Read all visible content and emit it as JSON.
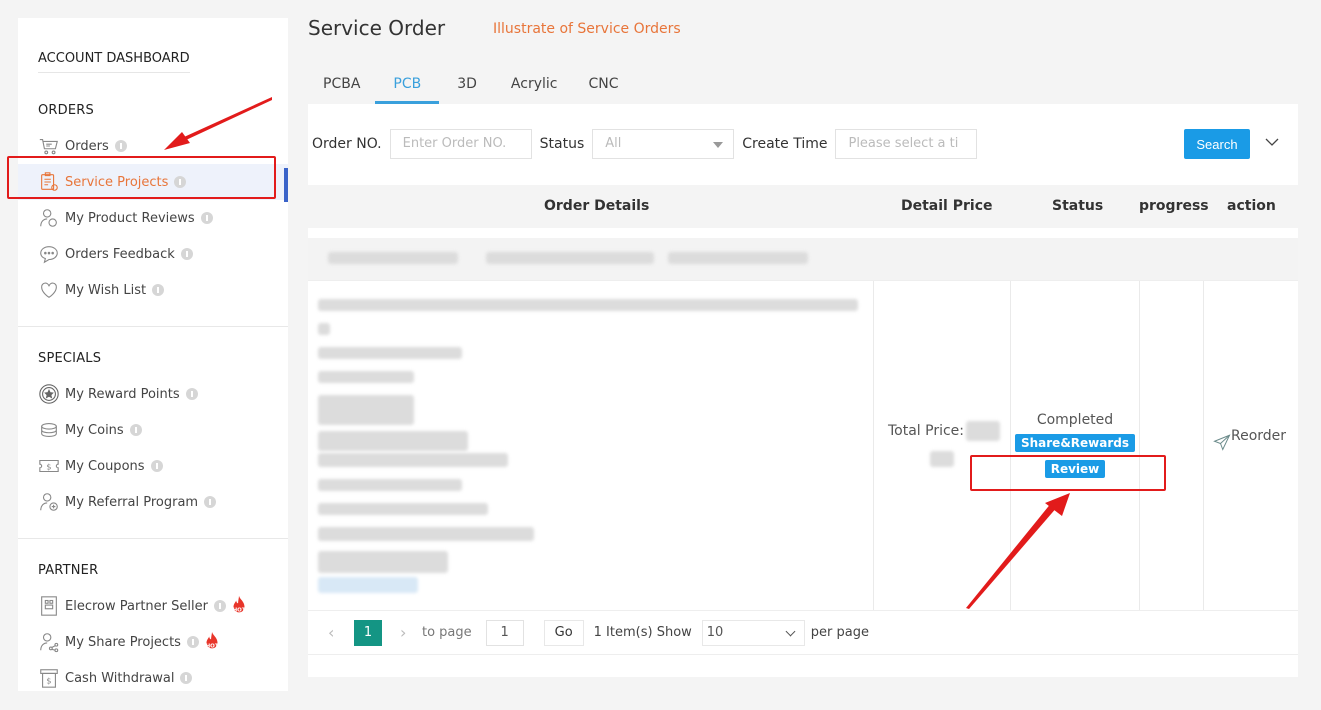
{
  "sidebar": {
    "dashboard_title": "ACCOUNT DASHBOARD",
    "sections": [
      {
        "title": "ORDERS",
        "items": [
          {
            "label": "Orders",
            "icon": "cart-icon"
          },
          {
            "label": "Service Projects",
            "icon": "clipboard-icon",
            "active": true
          },
          {
            "label": "My Product Reviews",
            "icon": "user-review-icon"
          },
          {
            "label": "Orders Feedback",
            "icon": "chat-icon"
          },
          {
            "label": "My Wish List",
            "icon": "heart-icon"
          }
        ]
      },
      {
        "title": "SPECIALS",
        "items": [
          {
            "label": "My Reward Points",
            "icon": "star-badge-icon"
          },
          {
            "label": "My Coins",
            "icon": "coins-icon"
          },
          {
            "label": "My Coupons",
            "icon": "coupon-icon"
          },
          {
            "label": "My Referral Program",
            "icon": "user-plus-icon"
          }
        ]
      },
      {
        "title": "PARTNER",
        "items": [
          {
            "label": "Elecrow Partner Seller",
            "icon": "seller-icon",
            "badge": "HOT"
          },
          {
            "label": "My Share Projects",
            "icon": "share-user-icon",
            "badge": "HOT"
          },
          {
            "label": "Cash Withdrawal",
            "icon": "cash-icon"
          }
        ]
      }
    ]
  },
  "header": {
    "title": "Service Order",
    "illustrate_link": "Illustrate of Service Orders"
  },
  "tabs": [
    {
      "label": "PCBA"
    },
    {
      "label": "PCB",
      "active": true
    },
    {
      "label": "3D"
    },
    {
      "label": "Acrylic"
    },
    {
      "label": "CNC"
    }
  ],
  "filters": {
    "order_no_label": "Order NO.",
    "order_no_placeholder": "Enter Order NO.",
    "status_label": "Status",
    "status_value": "All",
    "create_time_label": "Create Time",
    "create_time_placeholder": "Please select a ti",
    "search_label": "Search"
  },
  "table": {
    "headers": [
      "Order Details",
      "Detail Price",
      "Status",
      "progress",
      "action"
    ],
    "row": {
      "total_price_label": "Total Price:",
      "status": "Completed",
      "share_rewards_label": "Share&Rewards",
      "review_label": "Review",
      "reorder_label": "Reorder"
    }
  },
  "pagination": {
    "current_page": "1",
    "to_page_label": "to page",
    "to_page_value": "1",
    "go_label": "Go",
    "items_text": "1 Item(s) Show",
    "per_page_value": "10",
    "per_page_label": "per page"
  },
  "colors": {
    "accent_orange": "#e8753a",
    "primary_blue": "#1a9be6",
    "page_green": "#149584",
    "annotation_red": "#e21b1b"
  }
}
